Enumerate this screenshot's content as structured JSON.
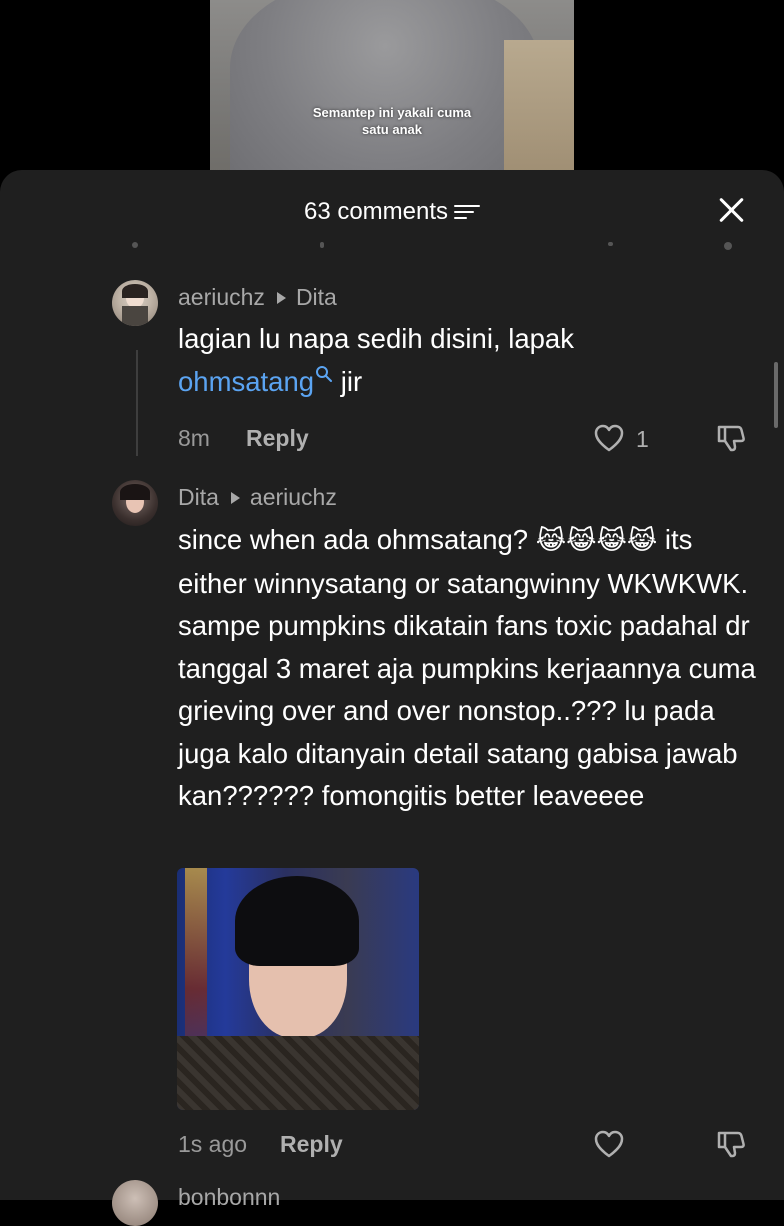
{
  "video": {
    "caption_line1": "Semantep ini yakali cuma",
    "caption_line2": "satu anak"
  },
  "header": {
    "comment_count": "63 comments",
    "filter_icon": "filter-icon",
    "close_icon": "close-icon"
  },
  "comments": [
    {
      "username": "aeriuchz",
      "reply_to": "Dita",
      "text_before": "lagian lu napa sedih disini, lapak",
      "mention": "ohmsatang",
      "text_after": " jir",
      "time": "8m",
      "reply_label": "Reply",
      "likes": "1"
    },
    {
      "username": "Dita",
      "reply_to": "aeriuchz",
      "text_line1": "since when ada ohmsatang? ",
      "emoji": "😹😹😹😹",
      "text_rest": "its either winnysatang or satangwinny WKWKWK. sampe pumpkins dikatain fans toxic padahal dr tanggal 3 maret aja pumpkins kerjaannya cuma grieving over and over nonstop..??? lu pada juga kalo ditanyain detail satang gabisa jawab kan?????? fomongitis better leaveeee",
      "time": "1s ago",
      "reply_label": "Reply"
    },
    {
      "username": "bonbonnn",
      "reply_to": ""
    }
  ],
  "colors": {
    "sheet_bg": "#1f1f1f",
    "mention": "#5ba4f2",
    "muted": "#a8a8a8"
  }
}
